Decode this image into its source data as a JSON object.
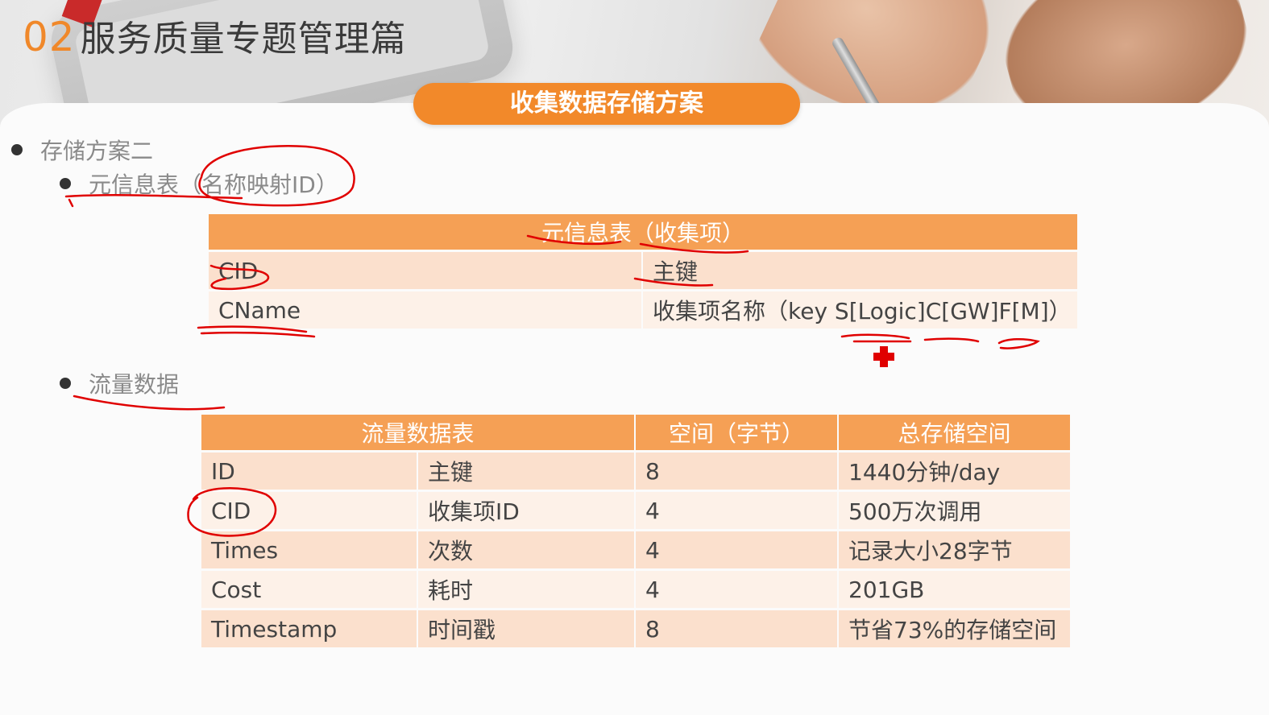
{
  "slide": {
    "number": "02",
    "title": "服务质量专题管理篇",
    "banner": "收集数据存储方案"
  },
  "bullets": {
    "plan": "存储方案二",
    "meta": "元信息表（名称映射ID）",
    "flow": "流量数据"
  },
  "meta_table": {
    "header": "元信息表（收集项）",
    "rows": [
      {
        "field": "CID",
        "desc": "主键"
      },
      {
        "field": "CName",
        "desc": "收集项名称（key S[Logic]C[GW]F[M]）"
      }
    ]
  },
  "flow_table": {
    "headers": [
      "流量数据表",
      "空间（字节）",
      "总存储空间"
    ],
    "rows": [
      {
        "field": "ID",
        "desc": "主键",
        "size": "8",
        "total": "1440分钟/day"
      },
      {
        "field": "CID",
        "desc": "收集项ID",
        "size": "4",
        "total": "500万次调用"
      },
      {
        "field": "Times",
        "desc": "次数",
        "size": "4",
        "total": "记录大小28字节"
      },
      {
        "field": "Cost",
        "desc": "耗时",
        "size": "4",
        "total": "201GB"
      },
      {
        "field": "Timestamp",
        "desc": "时间戳",
        "size": "8",
        "total": "节省73%的存储空间"
      }
    ]
  },
  "colors": {
    "accent": "#f2892a",
    "header_bg": "#f5a055",
    "row_dark": "#fbe0cd",
    "row_light": "#fdf1e8",
    "annotation": "#e00000"
  }
}
